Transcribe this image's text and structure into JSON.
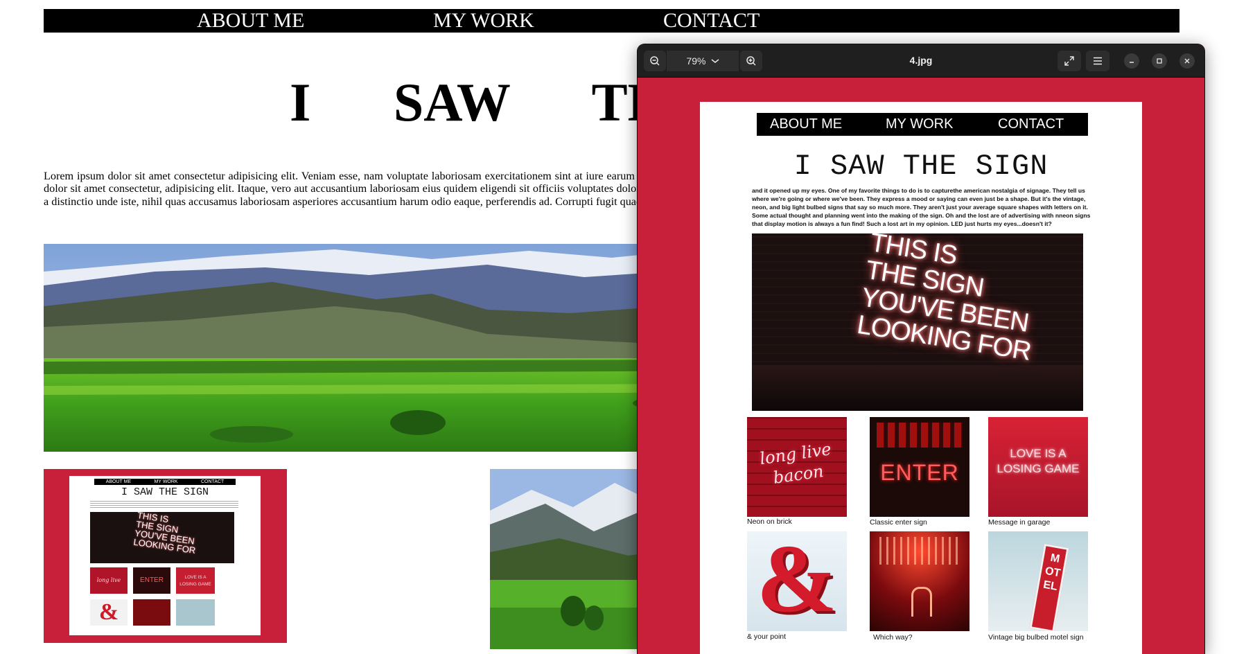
{
  "site": {
    "nav": [
      "ABOUT ME",
      "MY WORK",
      "CONTACT"
    ],
    "title": "I SAW THE SIGN",
    "intro": "Lorem ipsum dolor sit amet consectetur adipisicing elit. Veniam esse, nam voluptate laboriosam exercitationem sint at iure earum officiis voluptates. Odit aut voluptatum, soluta nulla quo cum pariatur eveniet unde, commodi molestiae. Lorem ipsum dolor sit amet consectetur, adipisicing elit. Itaque, vero aut accusantium laboriosam eius quidem eligendi sit officiis voluptates dolorum aliquam adipisci culpa, pariatur mollitia placeat sequi iure quaerat repudiandae quod. Rerum quo voluptatem, eaque a distinctio unde iste, nihil quas accusamus laboriosam asperiores accusantium harum odio eaque, perferendis ad. Corrupti fugit quae officia eligendi cupiditate, qui consectetur laborum eius nihil nulla quo placeat laborum repellendus! Possimus fugiat"
  },
  "viewer": {
    "zoom": "79%",
    "filename": "4.jpg"
  },
  "mockup": {
    "nav": [
      "ABOUT ME",
      "MY WORK",
      "CONTACT"
    ],
    "title": "I SAW THE SIGN",
    "body": "and it opened up my eyes. One of my favorite things to do is to capturethe american nostalgia of signage. They tell us where we're going or where we've been. They express a mood or saying can even just be a shape. But it's the vintage, neon, and big light bulbed signs that say so much more. They aren't just your average square shapes with letters on it. Some actual thought and planning went into the making of the sign. Oh and the lost are of advertising with nneon signs that display motion is always a fun find! Such a lost art in my opinion. LED just hurts my eyes...doesn't it?",
    "hero_sign": [
      "THIS IS",
      "THE SIGN",
      "YOU'VE BEEN",
      "LOOKING FOR"
    ],
    "tiles": [
      {
        "caption": "Neon on brick",
        "sign": [
          "long live",
          "bacon"
        ]
      },
      {
        "caption": "Classic enter sign",
        "sign": [
          "ENTER"
        ]
      },
      {
        "caption": "Message in garage",
        "sign": [
          "LOVE IS A",
          "LOSING GAME"
        ]
      },
      {
        "caption": "& your point",
        "sign": [
          "&"
        ]
      },
      {
        "caption": "Which way?",
        "sign": []
      },
      {
        "caption": "Vintage big bulbed motel sign",
        "sign": [
          "MOTEL"
        ]
      }
    ]
  },
  "thumb_mockup": {
    "nav": [
      "ABOUT ME",
      "MY WORK",
      "CONTACT"
    ],
    "title": "I SAW THE SIGN",
    "hero_sign": [
      "THIS IS",
      "THE SIGN",
      "YOU'VE BEEN",
      "LOOKING FOR"
    ],
    "tile_text": [
      "long live bacon",
      "ENTER",
      "LOVE IS A LOSING GAME"
    ]
  },
  "colors": {
    "brand_red": "#c8203a",
    "nav_black": "#000000",
    "viewer_header": "#1f1f1f"
  },
  "icons": [
    "zoom-out-icon",
    "chevron-down-icon",
    "zoom-in-icon",
    "fullscreen-icon",
    "hamburger-menu-icon",
    "minimize-icon",
    "maximize-icon",
    "close-icon"
  ]
}
